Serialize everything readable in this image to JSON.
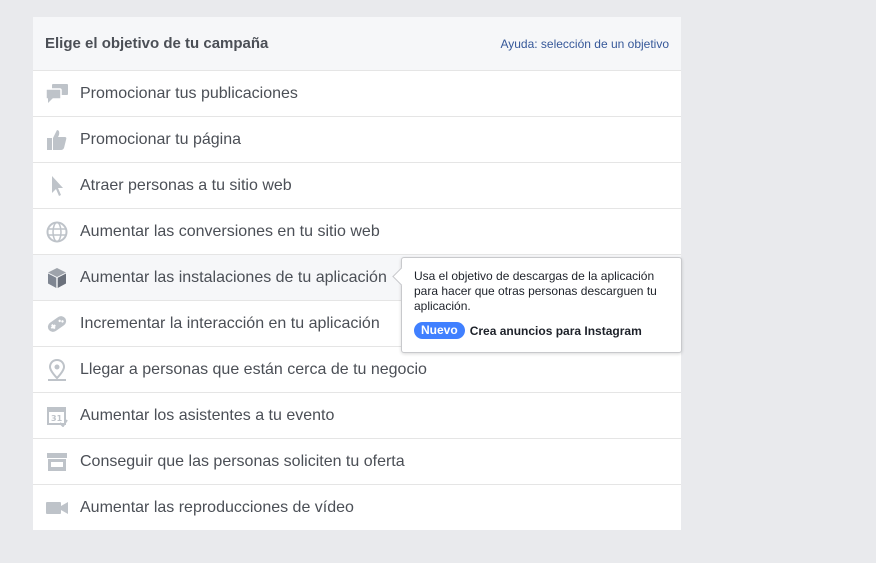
{
  "header": {
    "title": "Elige el objetivo de tu campaña",
    "help_link": "Ayuda: selección de un objetivo"
  },
  "objectives": [
    {
      "label": "Promocionar tus publicaciones",
      "icon": "speech-bubbles-icon"
    },
    {
      "label": "Promocionar tu página",
      "icon": "thumbs-up-icon"
    },
    {
      "label": "Atraer personas a tu sitio web",
      "icon": "cursor-icon"
    },
    {
      "label": "Aumentar las conversiones en tu sitio web",
      "icon": "globe-icon"
    },
    {
      "label": "Aumentar las instalaciones de tu aplicación",
      "icon": "cube-icon"
    },
    {
      "label": "Incrementar la interacción en tu aplicación",
      "icon": "gamepad-icon"
    },
    {
      "label": "Llegar a personas que están cerca de tu negocio",
      "icon": "location-pin-icon"
    },
    {
      "label": "Aumentar los asistentes a tu evento",
      "icon": "calendar-icon"
    },
    {
      "label": "Conseguir que las personas soliciten tu oferta",
      "icon": "storefront-icon"
    },
    {
      "label": "Aumentar las reproducciones de vídeo",
      "icon": "video-camera-icon"
    }
  ],
  "tooltip": {
    "text": "Usa el objetivo de descargas de la aplicación para hacer que otras personas descarguen tu aplicación.",
    "badge": "Nuevo",
    "footer": "Crea anuncios para Instagram"
  },
  "colors": {
    "icon_gray": "#bec3c9",
    "icon_active": "#7f8692",
    "link_blue": "#365899",
    "badge_blue": "#4080ff"
  }
}
